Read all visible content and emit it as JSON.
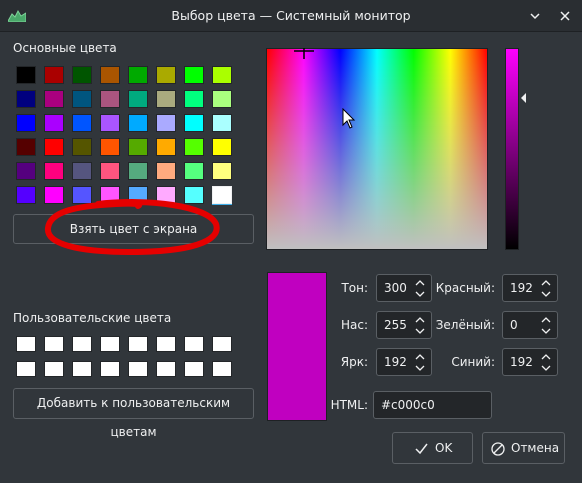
{
  "window": {
    "title": "Выбор цвета — Системный монитор"
  },
  "basic_colors": {
    "label": "Основные цвета",
    "swatches": [
      "#000000",
      "#aa0000",
      "#005500",
      "#aa5500",
      "#00aa00",
      "#aaaa00",
      "#00ff00",
      "#aaff00",
      "#00007f",
      "#aa007f",
      "#00557f",
      "#aa557f",
      "#00aa7f",
      "#aaaa7f",
      "#00ff7f",
      "#aaff7f",
      "#0000ff",
      "#aa00ff",
      "#0055ff",
      "#aa55ff",
      "#00aaff",
      "#aaaaff",
      "#00ffff",
      "#aaffff",
      "#550000",
      "#ff0000",
      "#555500",
      "#ff5500",
      "#55aa00",
      "#ffaa00",
      "#55ff00",
      "#ffff00",
      "#55007f",
      "#ff007f",
      "#55557f",
      "#ff557f",
      "#55aa7f",
      "#ffaa7f",
      "#55ff7f",
      "#ffff7f",
      "#5500ff",
      "#ff00ff",
      "#5555ff",
      "#ff55ff",
      "#55aaff",
      "#ffaaff",
      "#55ffff",
      "#ffffff"
    ],
    "selected_index": 47
  },
  "pick_screen_button": "Взять цвет с экрана",
  "custom_colors": {
    "label": "Пользовательские цвета",
    "count": 16
  },
  "add_custom_button": "Добавить к пользовательским цветам",
  "preview_color": "#c000c0",
  "fields": {
    "hue": {
      "label": "Тон:",
      "value": "300"
    },
    "sat": {
      "label": "Нас:",
      "value": "255"
    },
    "val": {
      "label": "Ярк:",
      "value": "192"
    },
    "red": {
      "label": "Красный:",
      "value": "192"
    },
    "green": {
      "label": "Зелёный:",
      "value": "0"
    },
    "blue": {
      "label": "Синий:",
      "value": "192"
    }
  },
  "html": {
    "label": "HTML:",
    "value": "#c000c0"
  },
  "buttons": {
    "ok": "OK",
    "cancel": "Отмена"
  },
  "annotation_color": "#e50000"
}
